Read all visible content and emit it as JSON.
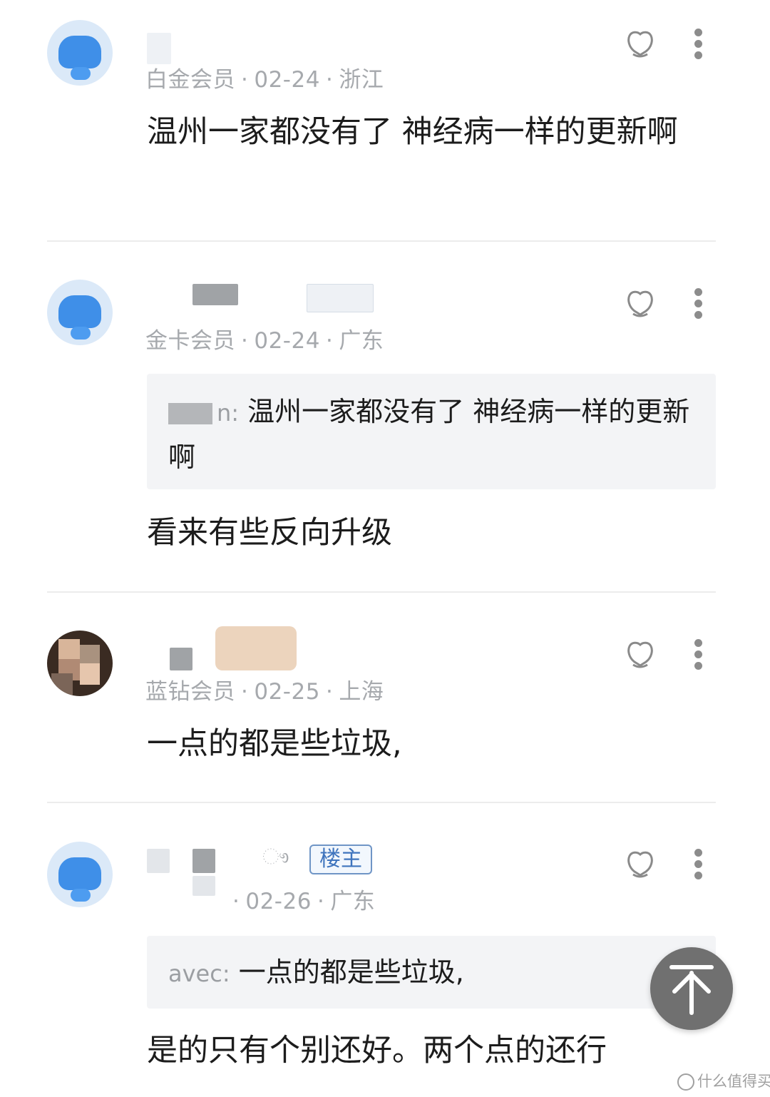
{
  "comments": [
    {
      "meta_level": "白金会员",
      "meta_date": "02-24",
      "meta_region": "浙江",
      "text": "温州一家都没有了  神经病一样的更新啊"
    },
    {
      "meta_level": "金卡会员",
      "meta_date": "02-24",
      "meta_region": "广东",
      "quote_user_suffix": "n:",
      "quote_text": "温州一家都没有了  神经病一样的更新啊",
      "text": "看来有些反向升级"
    },
    {
      "meta_level": "蓝钻会员",
      "meta_date": "02-25",
      "meta_region": "上海",
      "text": "一点的都是些垃圾,"
    },
    {
      "name_suffix": "ෟ",
      "badge": "楼主",
      "meta_level": "",
      "meta_date": "02-26",
      "meta_region": "广东",
      "quote_user": "avec:",
      "quote_text": "一点的都是些垃圾,",
      "text": "是的只有个别还好。两个点的还行"
    }
  ],
  "watermark": "什么值得买",
  "icons": {
    "like": "like-icon",
    "more": "more-icon",
    "back_to_top": "arrow-up-icon"
  },
  "colors": {
    "accent_badge": "#3f74bd",
    "avatar_blue": "#3f8fe8",
    "meta_gray": "#a6a9ad",
    "button_gray": "#707070"
  }
}
